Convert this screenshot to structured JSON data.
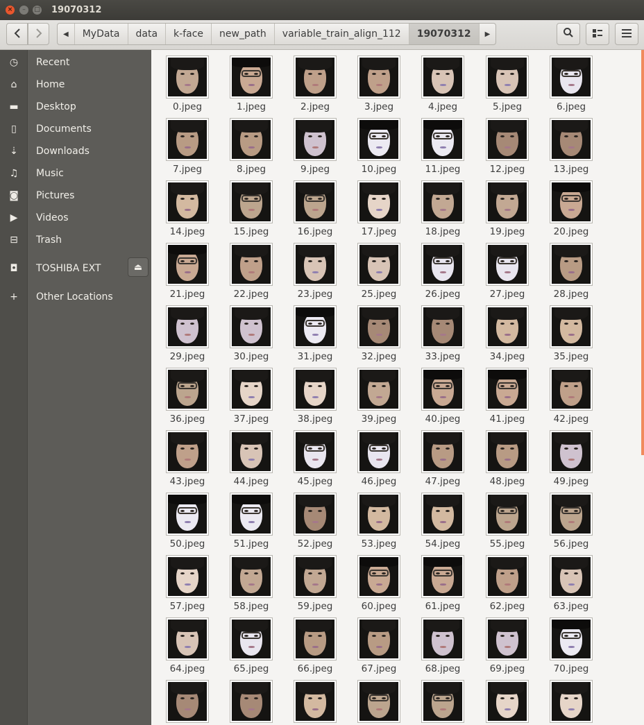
{
  "window": {
    "title": "19070312",
    "close_label": "×",
    "minimize_label": "–",
    "maximize_label": "□"
  },
  "header": {
    "back_icon": "◀",
    "forward_icon": "▶",
    "path_left_arrow": "◀",
    "path_right_arrow": "▶",
    "path": [
      "MyData",
      "data",
      "k-face",
      "new_path",
      "variable_train_align_112",
      "19070312"
    ],
    "search_icon": "search-icon",
    "view_icon": "list-view-icon",
    "menu_icon": "hamburger-menu-icon"
  },
  "sidebar": {
    "items": [
      {
        "label": "Recent",
        "icon": "clock-icon",
        "glyph": "◷"
      },
      {
        "label": "Home",
        "icon": "home-icon",
        "glyph": "⌂"
      },
      {
        "label": "Desktop",
        "icon": "folder-icon",
        "glyph": "▬"
      },
      {
        "label": "Documents",
        "icon": "document-icon",
        "glyph": "▯"
      },
      {
        "label": "Downloads",
        "icon": "download-icon",
        "glyph": "⇣"
      },
      {
        "label": "Music",
        "icon": "music-icon",
        "glyph": "♫"
      },
      {
        "label": "Pictures",
        "icon": "camera-icon",
        "glyph": "◙"
      },
      {
        "label": "Videos",
        "icon": "video-icon",
        "glyph": "▶"
      },
      {
        "label": "Trash",
        "icon": "trash-icon",
        "glyph": "⊟"
      },
      {
        "label": "TOSHIBA EXT",
        "icon": "drive-icon",
        "glyph": "◘"
      },
      {
        "label": "Other Locations",
        "icon": "plus-icon",
        "glyph": "+"
      }
    ],
    "eject_glyph": "⏏"
  },
  "files": [
    "0.jpeg",
    "1.jpeg",
    "2.jpeg",
    "3.jpeg",
    "4.jpeg",
    "5.jpeg",
    "6.jpeg",
    "7.jpeg",
    "8.jpeg",
    "9.jpeg",
    "10.jpeg",
    "11.jpeg",
    "12.jpeg",
    "13.jpeg",
    "14.jpeg",
    "15.jpeg",
    "16.jpeg",
    "17.jpeg",
    "18.jpeg",
    "19.jpeg",
    "20.jpeg",
    "21.jpeg",
    "22.jpeg",
    "23.jpeg",
    "25.jpeg",
    "26.jpeg",
    "27.jpeg",
    "28.jpeg",
    "29.jpeg",
    "30.jpeg",
    "31.jpeg",
    "32.jpeg",
    "33.jpeg",
    "34.jpeg",
    "35.jpeg",
    "36.jpeg",
    "37.jpeg",
    "38.jpeg",
    "39.jpeg",
    "40.jpeg",
    "41.jpeg",
    "42.jpeg",
    "43.jpeg",
    "44.jpeg",
    "45.jpeg",
    "46.jpeg",
    "47.jpeg",
    "48.jpeg",
    "49.jpeg",
    "50.jpeg",
    "51.jpeg",
    "52.jpeg",
    "53.jpeg",
    "54.jpeg",
    "55.jpeg",
    "56.jpeg",
    "57.jpeg",
    "58.jpeg",
    "59.jpeg",
    "60.jpeg",
    "61.jpeg",
    "62.jpeg",
    "63.jpeg",
    "64.jpeg",
    "65.jpeg",
    "66.jpeg",
    "67.jpeg",
    "68.jpeg",
    "69.jpeg",
    "70.jpeg",
    "",
    "",
    "",
    "",
    "",
    "",
    ""
  ],
  "colors": {
    "accent": "#f08a5d",
    "sidebar": "#5d5c58",
    "titlebar": "#3c3b37"
  }
}
